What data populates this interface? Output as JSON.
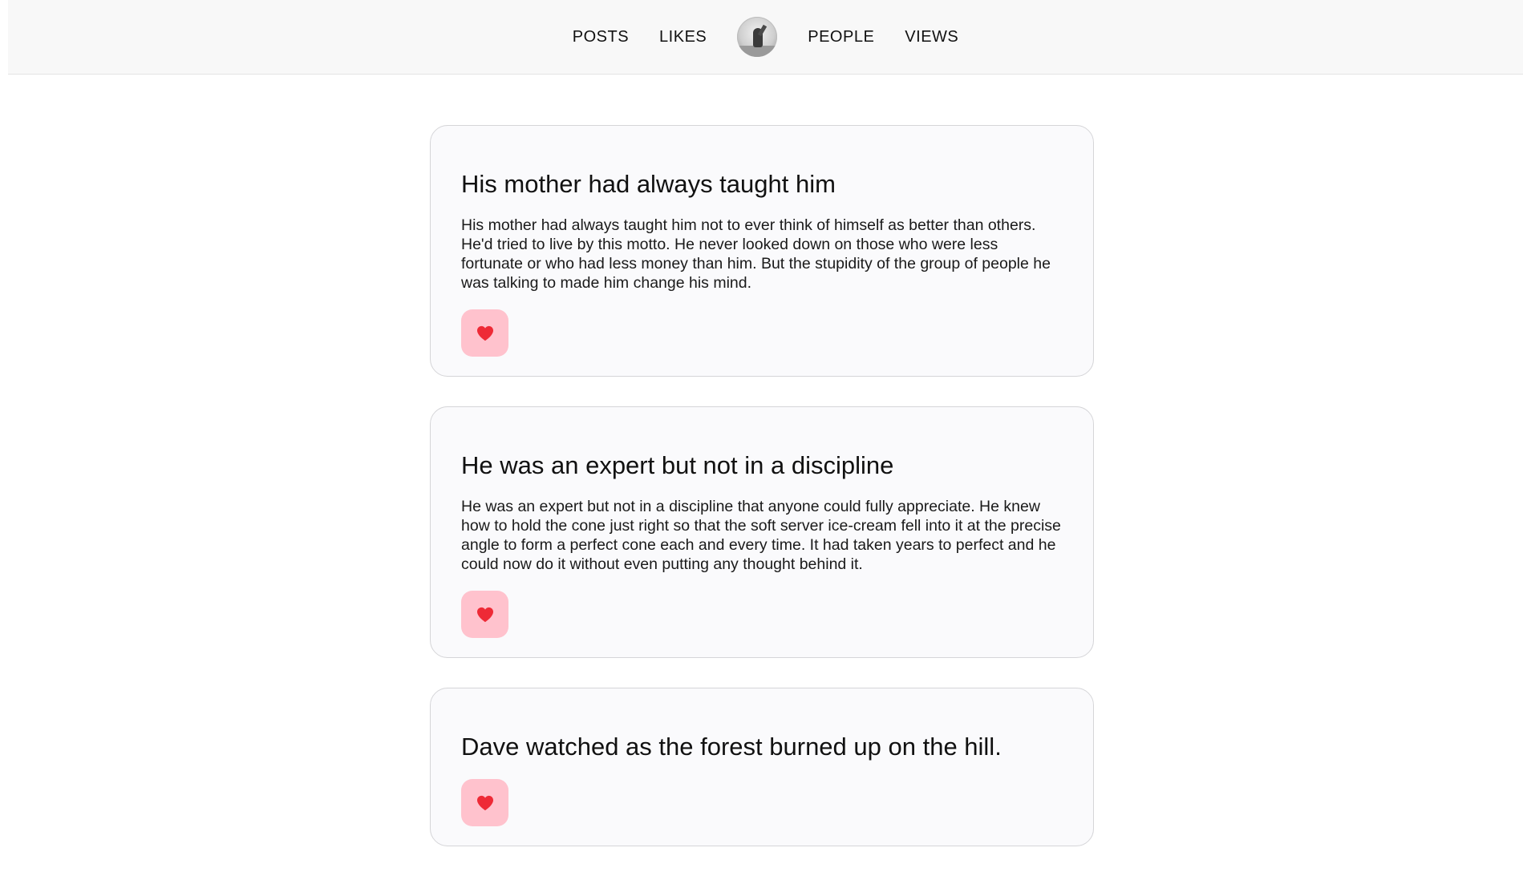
{
  "nav": {
    "posts_label": "POSTS",
    "likes_label": "LIKES",
    "avatar_icon": "profile-avatar",
    "people_label": "PEOPLE",
    "views_label": "VIEWS"
  },
  "colors": {
    "header_bg": "#f8f8f8",
    "card_bg": "#fafafc",
    "like_button_bg": "#ffc2cd",
    "heart": "#ee2a36"
  },
  "posts": [
    {
      "title": "His mother had always taught him",
      "body": "His mother had always taught him not to ever think of himself as better than others. He'd tried to live by this motto. He never looked down on those who were less fortunate or who had less money than him. But the stupidity of the group of people he was talking to made him change his mind.",
      "like_icon": "heart-icon"
    },
    {
      "title": "He was an expert but not in a discipline",
      "body": "He was an expert but not in a discipline that anyone could fully appreciate. He knew how to hold the cone just right so that the soft server ice-cream fell into it at the precise angle to form a perfect cone each and every time. It had taken years to perfect and he could now do it without even putting any thought behind it.",
      "like_icon": "heart-icon"
    },
    {
      "title": "Dave watched as the forest burned up on the hill.",
      "body": "",
      "like_icon": "heart-icon"
    }
  ]
}
